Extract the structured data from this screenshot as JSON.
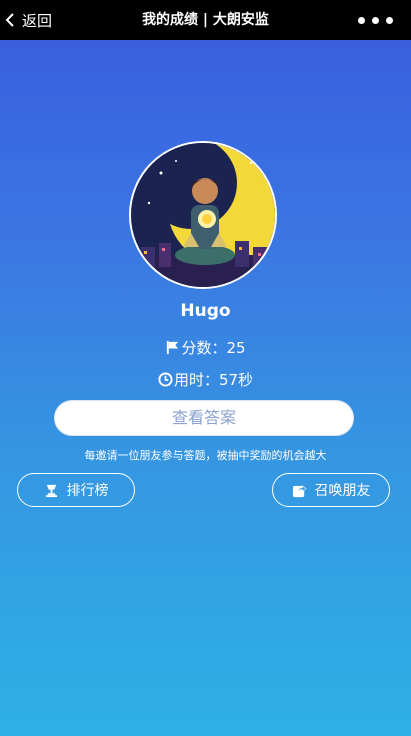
{
  "nav": {
    "back_label": "返回",
    "title": "我的成绩 | 大朗安监"
  },
  "profile": {
    "username": "Hugo"
  },
  "stats": {
    "score_text": "分数：25",
    "time_text": "用时：57秒"
  },
  "actions": {
    "answer_label": "查看答案",
    "invite_tip": "每邀请一位朋友参与答题，被抽中奖励的机会越大",
    "rank_label": "排行榜",
    "summon_label": "召唤朋友"
  },
  "icons": {
    "back": "chevron-left-icon",
    "more": "more-dots-icon",
    "score": "flag-icon",
    "time": "clock-icon",
    "rank": "trophy-icon",
    "summon": "share-icon"
  },
  "colors": {
    "navbar": "#000000",
    "gradient_top": "#3a5fe0",
    "gradient_bottom": "#2eb1e4",
    "answer_text": "#8aa2cf"
  }
}
